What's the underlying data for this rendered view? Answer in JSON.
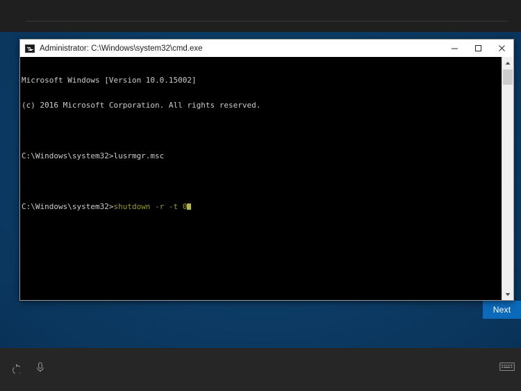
{
  "setup": {
    "next_label": "Next",
    "accent_color": "#0c6aba",
    "background_color": "#0b3d66"
  },
  "console_window": {
    "title": "Administrator: C:\\Windows\\system32\\cmd.exe",
    "app_icon": "cmd-icon",
    "controls": {
      "minimize": "─",
      "maximize": "☐",
      "close": "✕"
    },
    "scrollbar": {
      "up_arrow": "▲",
      "down_arrow": "▼"
    },
    "lines": {
      "l1": "Microsoft Windows [Version 10.0.15002]",
      "l2": "(c) 2016 Microsoft Corporation. All rights reserved.",
      "l3": "",
      "l4": "C:\\Windows\\system32>lusrmgr.msc",
      "l5": "",
      "prompt": "C:\\Windows\\system32>",
      "command": "shutdown",
      "args": " -r -t 0"
    },
    "text_color": "#cccccc",
    "command_color": "#9a9a22",
    "background_color": "#000000"
  },
  "taskbar": {
    "power_icon": "power-icon",
    "mic_icon": "microphone-icon",
    "keyboard_icon": "keyboard-icon"
  }
}
